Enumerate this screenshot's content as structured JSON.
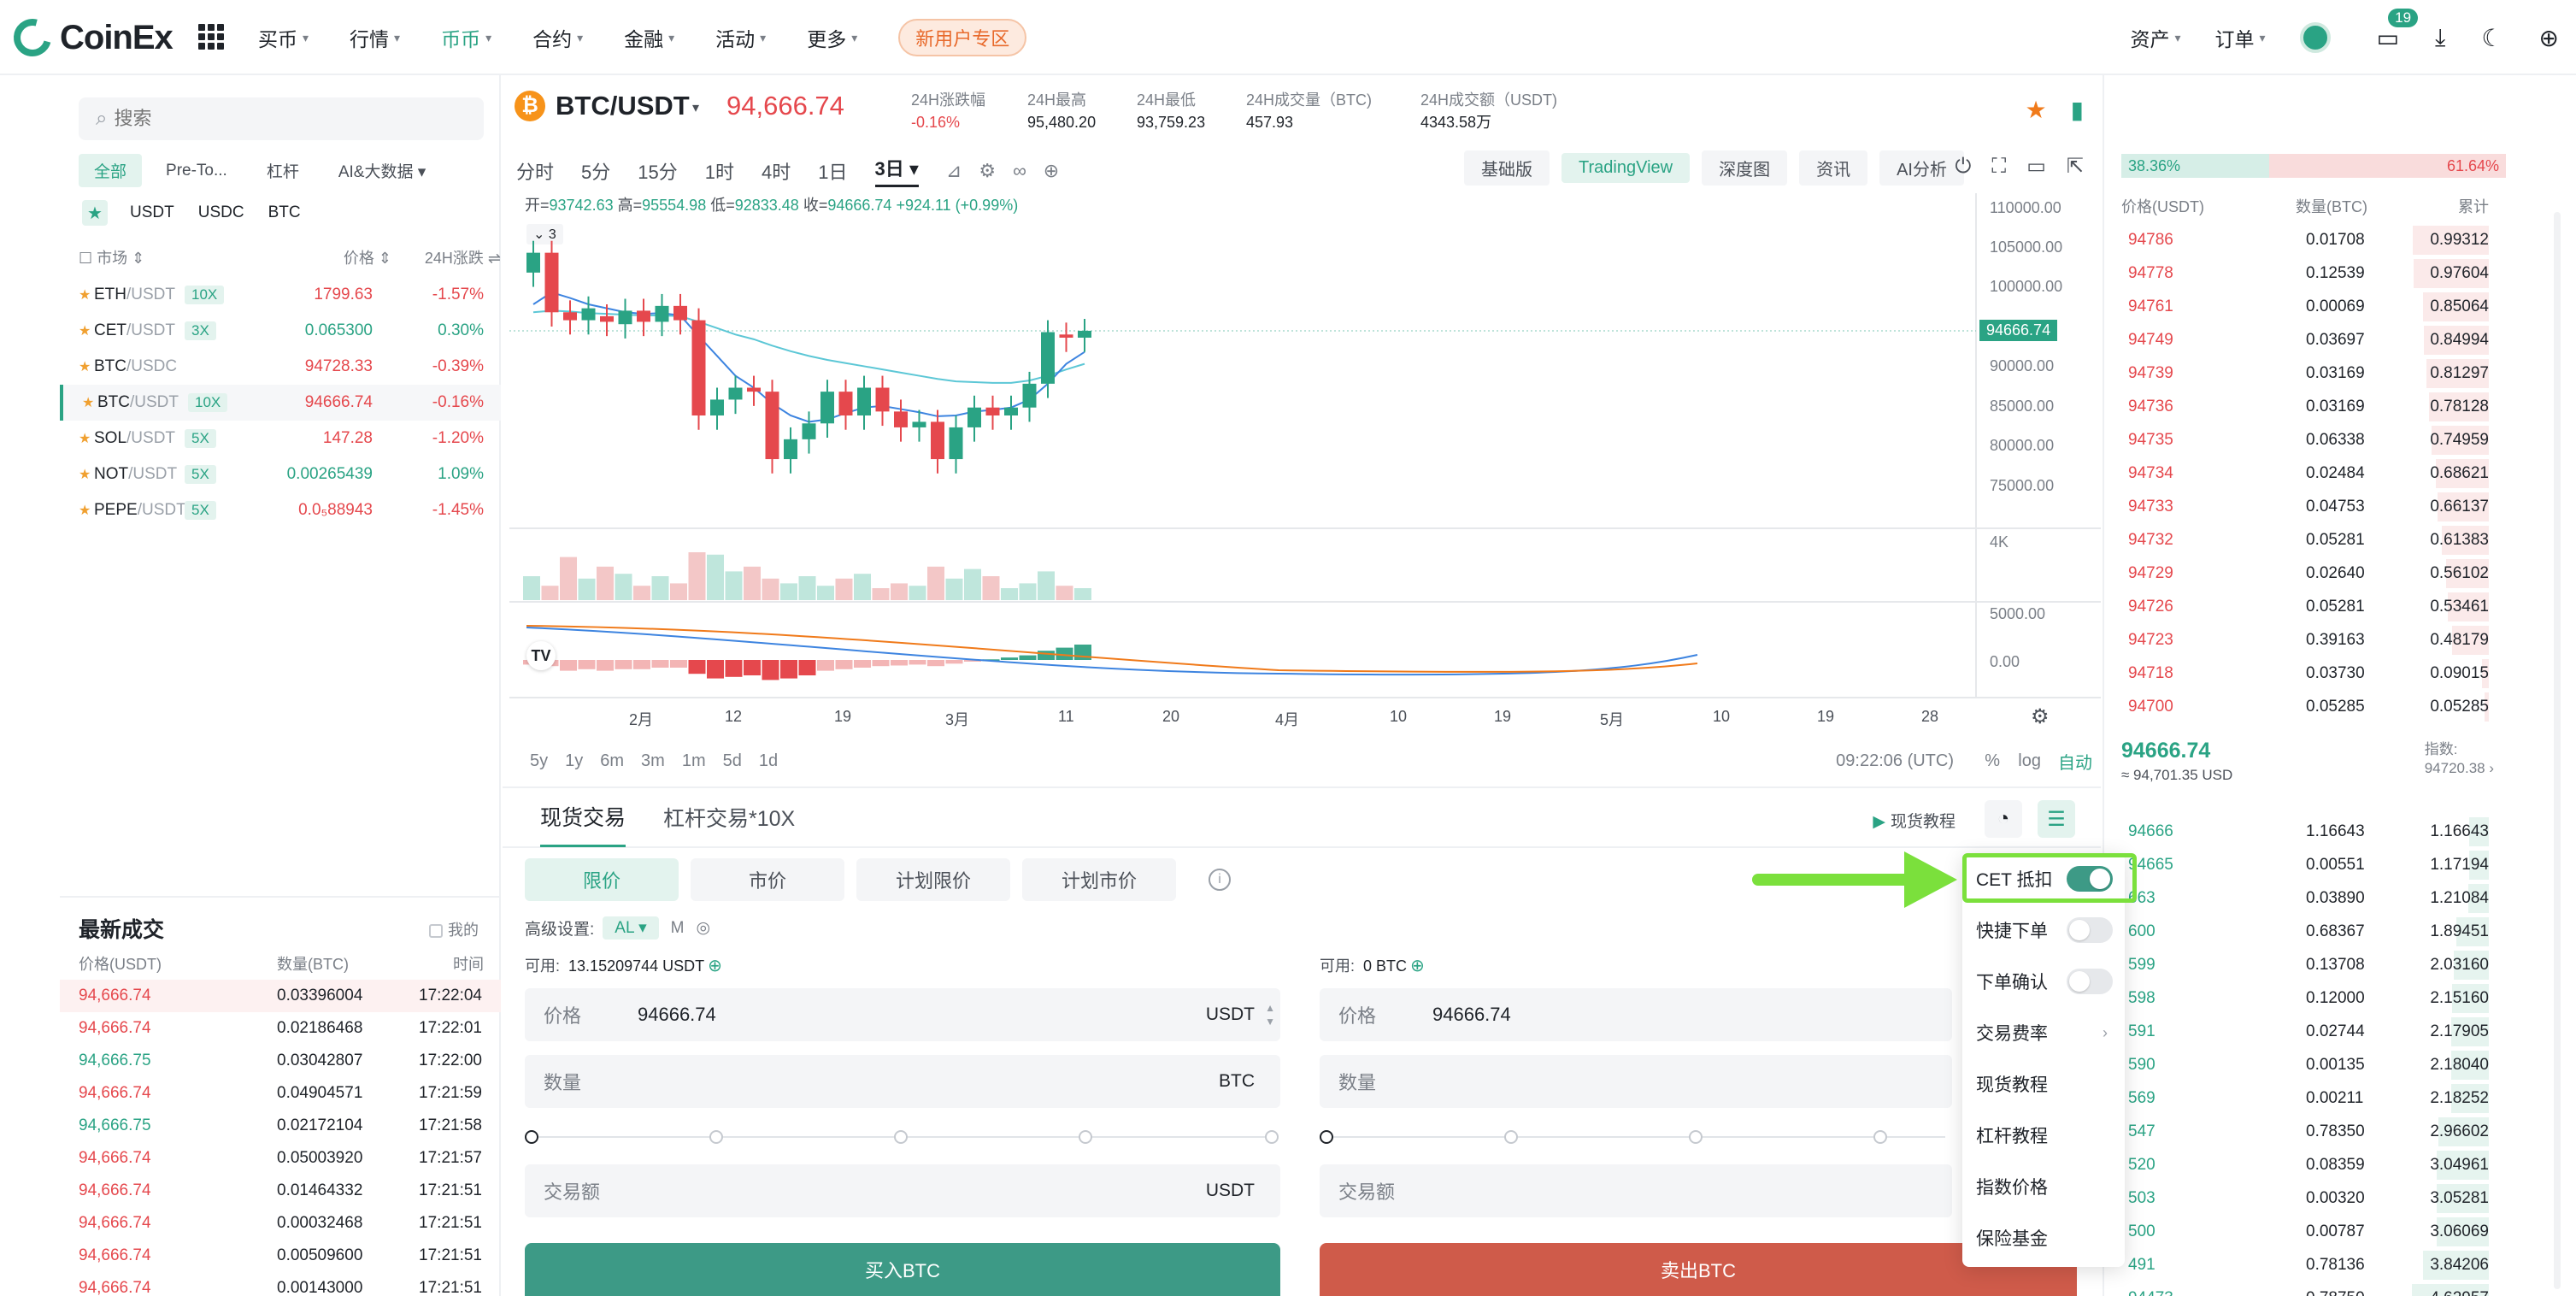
{
  "brand": {
    "name": "CoinEx"
  },
  "nav": {
    "items": [
      {
        "label": "买币",
        "caret": "▾"
      },
      {
        "label": "行情",
        "caret": "▾"
      },
      {
        "label": "币币",
        "caret": "▾"
      },
      {
        "label": "合约",
        "caret": "▾"
      },
      {
        "label": "金融",
        "caret": "▾"
      },
      {
        "label": "活动",
        "caret": "▾"
      },
      {
        "label": "更多",
        "caret": "▾"
      }
    ],
    "promo": "新用户专区",
    "right": [
      {
        "label": "资产"
      },
      {
        "label": "订单"
      }
    ],
    "badge_count": "19"
  },
  "market": {
    "search_placeholder": "搜索",
    "filter_tabs": [
      "全部",
      "Pre-To...",
      "杠杆",
      "AI&大数据 ▾"
    ],
    "quote_tabs": [
      "USDT",
      "USDC",
      "BTC"
    ],
    "head": {
      "market": "市场",
      "price": "价格",
      "change": "24H涨跌"
    },
    "rows": [
      {
        "base": "ETH",
        "quote": "/USDT",
        "lev": "10X",
        "price": "1799.63",
        "change": "-1.57%",
        "dir": "red"
      },
      {
        "base": "CET",
        "quote": "/USDT",
        "lev": "3X",
        "price": "0.065300",
        "change": "0.30%",
        "dir": "green"
      },
      {
        "base": "BTC",
        "quote": "/USDC",
        "lev": "",
        "price": "94728.33",
        "change": "-0.39%",
        "dir": "red"
      },
      {
        "base": "BTC",
        "quote": "/USDT",
        "lev": "10X",
        "price": "94666.74",
        "change": "-0.16%",
        "dir": "red"
      },
      {
        "base": "SOL",
        "quote": "/USDT",
        "lev": "5X",
        "price": "147.28",
        "change": "-1.20%",
        "dir": "red"
      },
      {
        "base": "NOT",
        "quote": "/USDT",
        "lev": "5X",
        "price": "0.00265439",
        "change": "1.09%",
        "dir": "green"
      },
      {
        "base": "PEPE",
        "quote": "/USDT",
        "lev": "5X",
        "price": "0.0₅88943",
        "change": "-1.45%",
        "dir": "red"
      }
    ]
  },
  "trades": {
    "title": "最新成交",
    "mine": "我的",
    "head": {
      "price": "价格(USDT)",
      "qty": "数量(BTC)",
      "time": "时间"
    },
    "rows": [
      {
        "price": "94,666.74",
        "qty": "0.03396004",
        "time": "17:22:04",
        "dir": "red"
      },
      {
        "price": "94,666.74",
        "qty": "0.02186468",
        "time": "17:22:01",
        "dir": "red"
      },
      {
        "price": "94,666.75",
        "qty": "0.03042807",
        "time": "17:22:00",
        "dir": "green"
      },
      {
        "price": "94,666.74",
        "qty": "0.04904571",
        "time": "17:21:59",
        "dir": "red"
      },
      {
        "price": "94,666.75",
        "qty": "0.02172104",
        "time": "17:21:58",
        "dir": "green"
      },
      {
        "price": "94,666.74",
        "qty": "0.05003920",
        "time": "17:21:57",
        "dir": "red"
      },
      {
        "price": "94,666.74",
        "qty": "0.01464332",
        "time": "17:21:51",
        "dir": "red"
      },
      {
        "price": "94,666.74",
        "qty": "0.00032468",
        "time": "17:21:51",
        "dir": "red"
      },
      {
        "price": "94,666.74",
        "qty": "0.00509600",
        "time": "17:21:51",
        "dir": "red"
      },
      {
        "price": "94,666.74",
        "qty": "0.00143000",
        "time": "17:21:51",
        "dir": "red"
      }
    ]
  },
  "ticker": {
    "symbol_icon": "₿",
    "pair": "BTC/USDT",
    "price": "94,666.74",
    "stats": [
      {
        "label": "24H涨跌幅",
        "value": "-0.16%",
        "dir": "red"
      },
      {
        "label": "24H最高",
        "value": "95,480.20",
        "dir": ""
      },
      {
        "label": "24H最低",
        "value": "93,759.23",
        "dir": ""
      },
      {
        "label": "24H成交量（BTC)",
        "value": "457.93",
        "dir": ""
      },
      {
        "label": "24H成交额（USDT)",
        "value": "4343.58万",
        "dir": ""
      }
    ]
  },
  "chart_toolbar": {
    "timeframes": [
      "分时",
      "5分",
      "15分",
      "1时",
      "4时",
      "1日",
      "3日 ▾"
    ],
    "active_timeframe": "3日 ▾",
    "views": [
      "基础版",
      "TradingView",
      "深度图",
      "资讯",
      "AI分析"
    ],
    "active_view": "TradingView"
  },
  "chart": {
    "ohlc": {
      "open_label": "开=",
      "open": "93742.63",
      "high_label": "高=",
      "high": "95554.98",
      "low_label": "低=",
      "low": "92833.48",
      "close_label": "收=",
      "close": "94666.74",
      "change": "+924.11 (+0.99%)"
    },
    "legend_collapse": "3",
    "current_price_tag": "94666.74",
    "time_readout": "09:22:06 (UTC)",
    "ranges": [
      "5y",
      "1y",
      "6m",
      "3m",
      "1m",
      "5d",
      "1d"
    ],
    "scale_options": [
      "%",
      "log",
      "自动"
    ]
  },
  "chart_data": {
    "type": "candlestick",
    "yticks": [
      110000,
      105000,
      100000,
      95000,
      90000,
      85000,
      80000,
      75000
    ],
    "ytick_labels": [
      "110000.00",
      "105000.00",
      "100000.00",
      "95000.00",
      "90000.00",
      "85000.00",
      "80000.00",
      "75000.00"
    ],
    "ylim": [
      70000,
      112000
    ],
    "xtick_labels": [
      "2月",
      "12",
      "19",
      "3月",
      "11",
      "20",
      "4月",
      "10",
      "19",
      "5月",
      "10",
      "19",
      "28"
    ],
    "volume_tick": "4K",
    "macd_ticks": [
      "5000.00",
      "0.00"
    ],
    "candles": [
      {
        "o": 102000,
        "c": 104500
      },
      {
        "o": 104500,
        "c": 97000
      },
      {
        "o": 97000,
        "c": 96000
      },
      {
        "o": 96000,
        "c": 97500
      },
      {
        "o": 96500,
        "c": 95800
      },
      {
        "o": 95500,
        "c": 97200
      },
      {
        "o": 97200,
        "c": 95800
      },
      {
        "o": 95800,
        "c": 97800
      },
      {
        "o": 97800,
        "c": 96000
      },
      {
        "o": 96000,
        "c": 84000
      },
      {
        "o": 84000,
        "c": 86000
      },
      {
        "o": 86000,
        "c": 87500
      },
      {
        "o": 87500,
        "c": 87000
      },
      {
        "o": 87000,
        "c": 78500
      },
      {
        "o": 78500,
        "c": 81000
      },
      {
        "o": 81000,
        "c": 83000
      },
      {
        "o": 83000,
        "c": 87000
      },
      {
        "o": 87000,
        "c": 84000
      },
      {
        "o": 84000,
        "c": 87500
      },
      {
        "o": 87500,
        "c": 84500
      },
      {
        "o": 84500,
        "c": 82500
      },
      {
        "o": 82500,
        "c": 83200
      },
      {
        "o": 83200,
        "c": 78500
      },
      {
        "o": 78500,
        "c": 82500
      },
      {
        "o": 82500,
        "c": 85000
      },
      {
        "o": 85000,
        "c": 84000
      },
      {
        "o": 84000,
        "c": 85000
      },
      {
        "o": 85000,
        "c": 88000
      },
      {
        "o": 88000,
        "c": 94500
      },
      {
        "o": 94200,
        "c": 93800
      },
      {
        "o": 93800,
        "c": 94666
      }
    ],
    "volumes": [
      0.5,
      0.3,
      0.9,
      0.45,
      0.7,
      0.55,
      0.3,
      0.5,
      0.35,
      1.0,
      0.95,
      0.6,
      0.7,
      0.45,
      0.35,
      0.5,
      0.3,
      0.45,
      0.55,
      0.25,
      0.35,
      0.3,
      0.7,
      0.45,
      0.65,
      0.5,
      0.25,
      0.35,
      0.6,
      0.3,
      0.25
    ],
    "ma_fast": [
      98000,
      99500,
      98800,
      98000,
      97500,
      97000,
      96800,
      96900,
      96600,
      94000,
      91500,
      89000,
      87500,
      85500,
      84000,
      83200,
      83500,
      84300,
      85000,
      85200,
      84800,
      84400,
      83900,
      84000,
      84500,
      84700,
      85000,
      86000,
      88000,
      90500,
      92000
    ],
    "ma_slow": [
      97000,
      97200,
      97100,
      96900,
      96800,
      96700,
      96600,
      96600,
      96500,
      95800,
      95000,
      94200,
      93600,
      92800,
      92100,
      91500,
      91000,
      90600,
      90200,
      89800,
      89400,
      89000,
      88600,
      88300,
      88200,
      88100,
      88100,
      88400,
      89000,
      89800,
      90500
    ],
    "macd_hist": [
      -0.15,
      -0.2,
      -0.35,
      -0.3,
      -0.35,
      -0.3,
      -0.3,
      -0.25,
      -0.25,
      -0.45,
      -0.6,
      -0.55,
      -0.5,
      -0.65,
      -0.6,
      -0.5,
      -0.35,
      -0.3,
      -0.25,
      -0.2,
      -0.18,
      -0.15,
      -0.2,
      -0.12,
      -0.05,
      0.02,
      0.08,
      0.15,
      0.3,
      0.4,
      0.5
    ]
  },
  "order": {
    "tabs": [
      "现货交易",
      "杠杆交易*10X"
    ],
    "tutorial": "现货教程",
    "order_types": [
      "限价",
      "市价",
      "计划限价",
      "计划市价"
    ],
    "advanced_label": "高级设置:",
    "advanced_chip": "AL ▾",
    "advanced_m": "M",
    "buy": {
      "avail_label": "可用:",
      "avail_value": "13.15209744 USDT",
      "price_label": "价格",
      "price_value": "94666.74",
      "price_unit": "USDT",
      "qty_label": "数量",
      "qty_unit": "BTC",
      "amount_label": "交易额",
      "amount_unit": "USDT",
      "button": "买入BTC"
    },
    "sell": {
      "avail_label": "可用:",
      "avail_value": "0 BTC",
      "price_label": "价格",
      "price_value": "94666.74",
      "qty_label": "数量",
      "amount_label": "交易额",
      "button": "卖出BTC"
    }
  },
  "settings_menu": {
    "items": [
      {
        "label": "CET 抵扣",
        "kind": "toggle",
        "on": true
      },
      {
        "label": "快捷下单",
        "kind": "toggle",
        "on": false
      },
      {
        "label": "下单确认",
        "kind": "toggle",
        "on": false
      },
      {
        "label": "交易费率",
        "kind": "link"
      },
      {
        "label": "现货教程",
        "kind": "plain"
      },
      {
        "label": "杠杆教程",
        "kind": "plain"
      },
      {
        "label": "指数价格",
        "kind": "plain"
      },
      {
        "label": "保险基金",
        "kind": "plain"
      }
    ]
  },
  "orderbook": {
    "buy_ratio": "38.36%",
    "sell_ratio": "61.64%",
    "head": {
      "price": "价格(USDT)",
      "qty": "数量(BTC)",
      "total": "累计"
    },
    "asks": [
      {
        "p": "94786",
        "q": "0.01708",
        "t": "0.99312"
      },
      {
        "p": "94778",
        "q": "0.12539",
        "t": "0.97604"
      },
      {
        "p": "94761",
        "q": "0.00069",
        "t": "0.85064"
      },
      {
        "p": "94749",
        "q": "0.03697",
        "t": "0.84994"
      },
      {
        "p": "94739",
        "q": "0.03169",
        "t": "0.81297"
      },
      {
        "p": "94736",
        "q": "0.03169",
        "t": "0.78128"
      },
      {
        "p": "94735",
        "q": "0.06338",
        "t": "0.74959"
      },
      {
        "p": "94734",
        "q": "0.02484",
        "t": "0.68621"
      },
      {
        "p": "94733",
        "q": "0.04753",
        "t": "0.66137"
      },
      {
        "p": "94732",
        "q": "0.05281",
        "t": "0.61383"
      },
      {
        "p": "94729",
        "q": "0.02640",
        "t": "0.56102"
      },
      {
        "p": "94726",
        "q": "0.05281",
        "t": "0.53461"
      },
      {
        "p": "94723",
        "q": "0.39163",
        "t": "0.48179"
      },
      {
        "p": "94718",
        "q": "0.03730",
        "t": "0.09015"
      },
      {
        "p": "94700",
        "q": "0.05285",
        "t": "0.05285"
      }
    ],
    "mid_price": "94666.74",
    "mid_usd": "≈ 94,701.35  USD",
    "index_label": "指数:",
    "index_value": "94720.38",
    "bids": [
      {
        "p": "94666",
        "q": "1.16643",
        "t": "1.16643"
      },
      {
        "p": "94665",
        "q": "0.00551",
        "t": "1.17194"
      },
      {
        "p": "663",
        "q": "0.03890",
        "t": "1.21084"
      },
      {
        "p": "600",
        "q": "0.68367",
        "t": "1.89451"
      },
      {
        "p": "599",
        "q": "0.13708",
        "t": "2.03160"
      },
      {
        "p": "598",
        "q": "0.12000",
        "t": "2.15160"
      },
      {
        "p": "591",
        "q": "0.02744",
        "t": "2.17905"
      },
      {
        "p": "590",
        "q": "0.00135",
        "t": "2.18040"
      },
      {
        "p": "569",
        "q": "0.00211",
        "t": "2.18252"
      },
      {
        "p": "547",
        "q": "0.78350",
        "t": "2.96602"
      },
      {
        "p": "520",
        "q": "0.08359",
        "t": "3.04961"
      },
      {
        "p": "503",
        "q": "0.00320",
        "t": "3.05281"
      },
      {
        "p": "500",
        "q": "0.00787",
        "t": "3.06069"
      },
      {
        "p": "491",
        "q": "0.78136",
        "t": "3.84206"
      },
      {
        "p": "94473",
        "q": "0.78750",
        "t": "4.62957"
      }
    ]
  },
  "colors": {
    "accent": "#2aa384",
    "down": "#e5484d",
    "highlight": "#7be03c"
  }
}
